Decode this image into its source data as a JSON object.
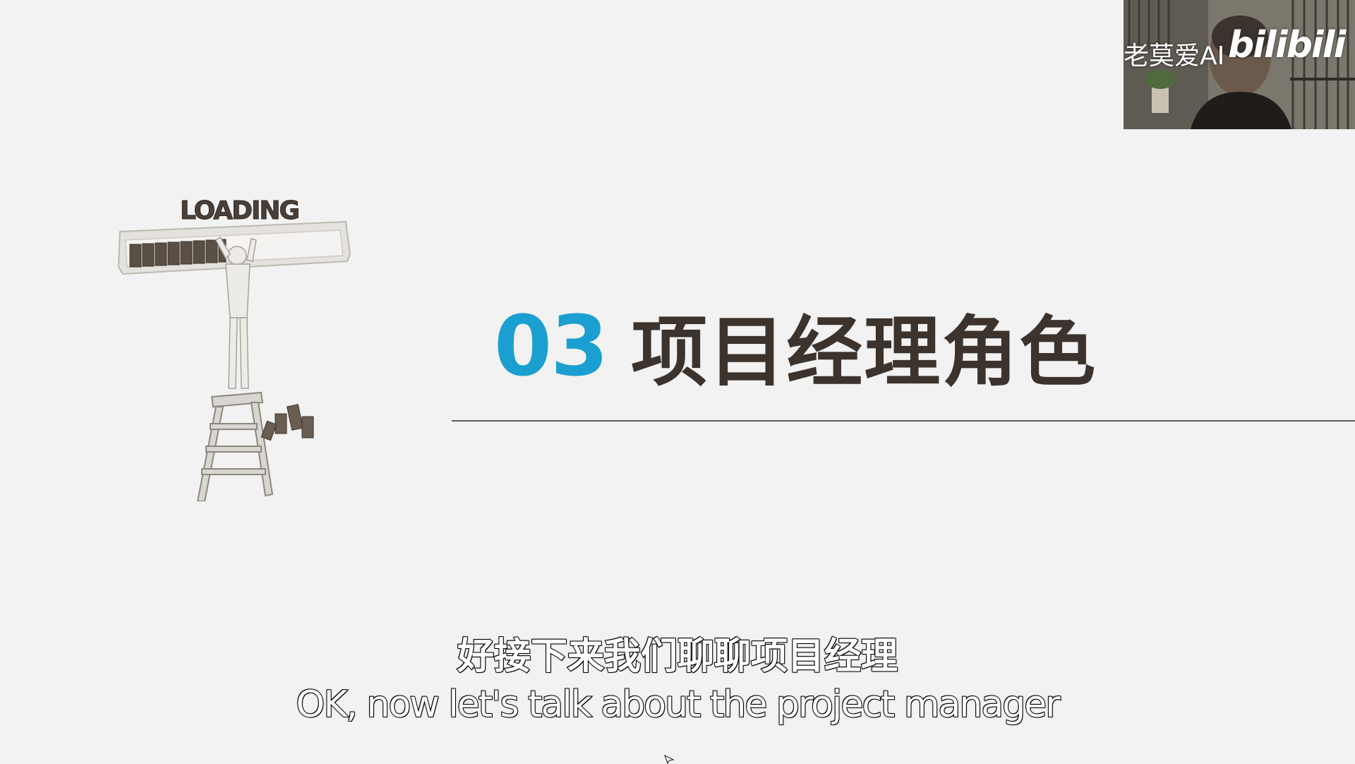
{
  "illustration": {
    "loading_text": "LOADING"
  },
  "section": {
    "number": "03",
    "title": "项目经理角色",
    "number_color": "#1a9fd0",
    "title_color": "#3b332c"
  },
  "webcam": {
    "watermark": "老莫爱AI",
    "logo": "bilibili"
  },
  "subtitles": {
    "zh": "好接下来我们聊聊项目经理",
    "en": "OK, now let's talk about the project manager"
  }
}
